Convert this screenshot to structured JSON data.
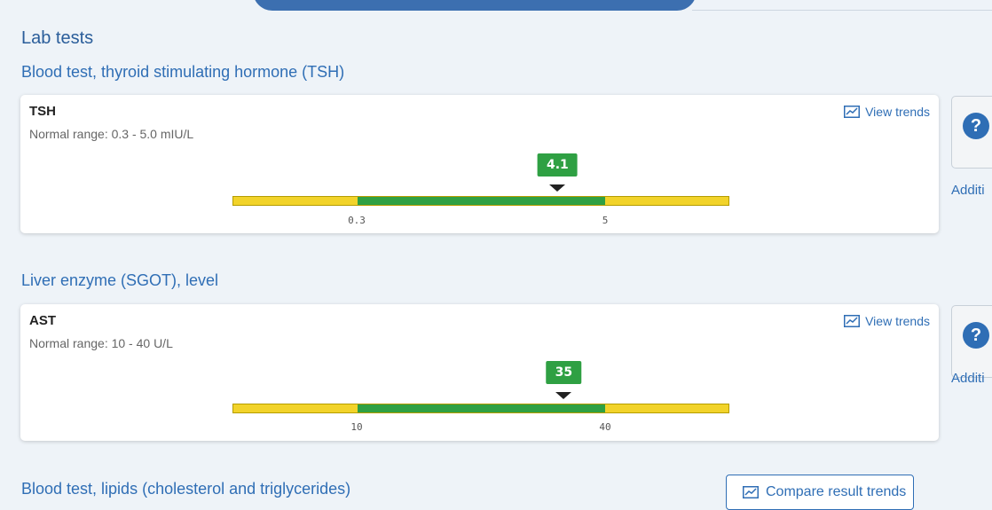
{
  "section_title": "Lab tests",
  "tests": [
    {
      "group": "Blood test, thyroid stimulating hormone (TSH)",
      "name": "TSH",
      "range_text": "Normal range: 0.3 - 5.0 mIU/L",
      "value_text": "4.1",
      "value": 4.1,
      "low": 0.3,
      "high": 5.0,
      "low_label": "0.3",
      "high_label": "5",
      "trends_label": "View trends",
      "additional_label": "Additi",
      "status_color": "#2fa043"
    },
    {
      "group": "Liver enzyme (SGOT), level",
      "name": "AST",
      "range_text": "Normal range: 10 - 40 U/L",
      "value_text": "35",
      "value": 35,
      "low": 10,
      "high": 40,
      "low_label": "10",
      "high_label": "40",
      "trends_label": "View trends",
      "additional_label": "Additi",
      "status_color": "#2fa043"
    }
  ],
  "next_group": "Blood test, lipids (cholesterol and triglycerides)",
  "compare_label": "Compare result trends",
  "icons": {
    "trends": "trend-chart-icon",
    "help": "question-icon"
  },
  "colors": {
    "normal": "#2fa043",
    "out_of_range": "#f2d32a",
    "accent": "#2f6eb5"
  }
}
